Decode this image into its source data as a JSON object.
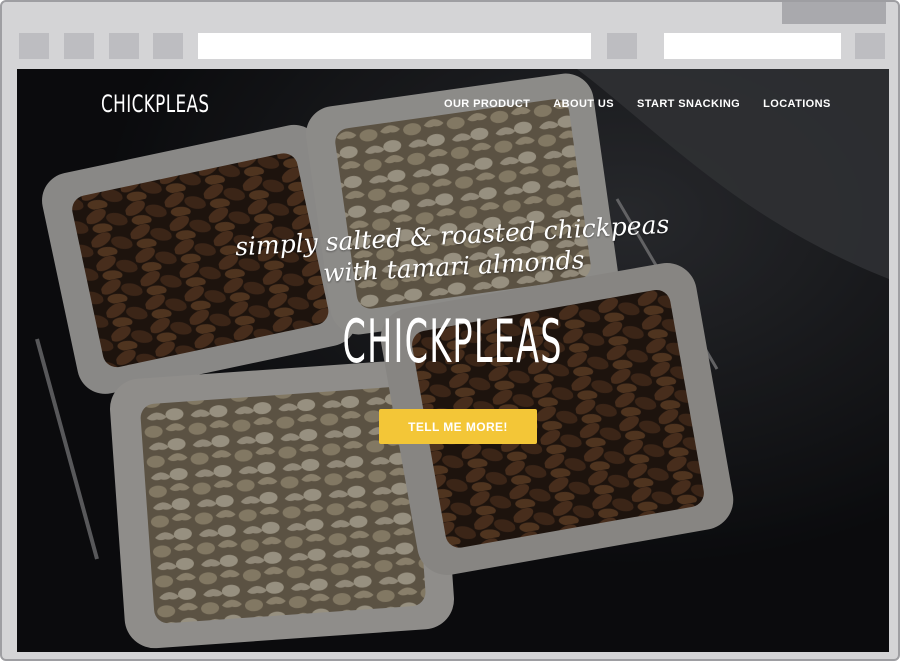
{
  "site": {
    "logo": "CHICKPLEAS",
    "nav": [
      {
        "label": "OUR PRODUCT"
      },
      {
        "label": "ABOUT US"
      },
      {
        "label": "START SNACKING"
      },
      {
        "label": "LOCATIONS"
      }
    ]
  },
  "hero": {
    "tagline_line1": "simply salted & roasted chickpeas",
    "tagline_line2": "with tamari almonds",
    "title": "CHICKPLEAS",
    "cta_label": "TELL ME MORE!"
  },
  "colors": {
    "accent": "#f3c637",
    "frame": "#d4d4d6",
    "hero_dark": "#0e0f10"
  }
}
